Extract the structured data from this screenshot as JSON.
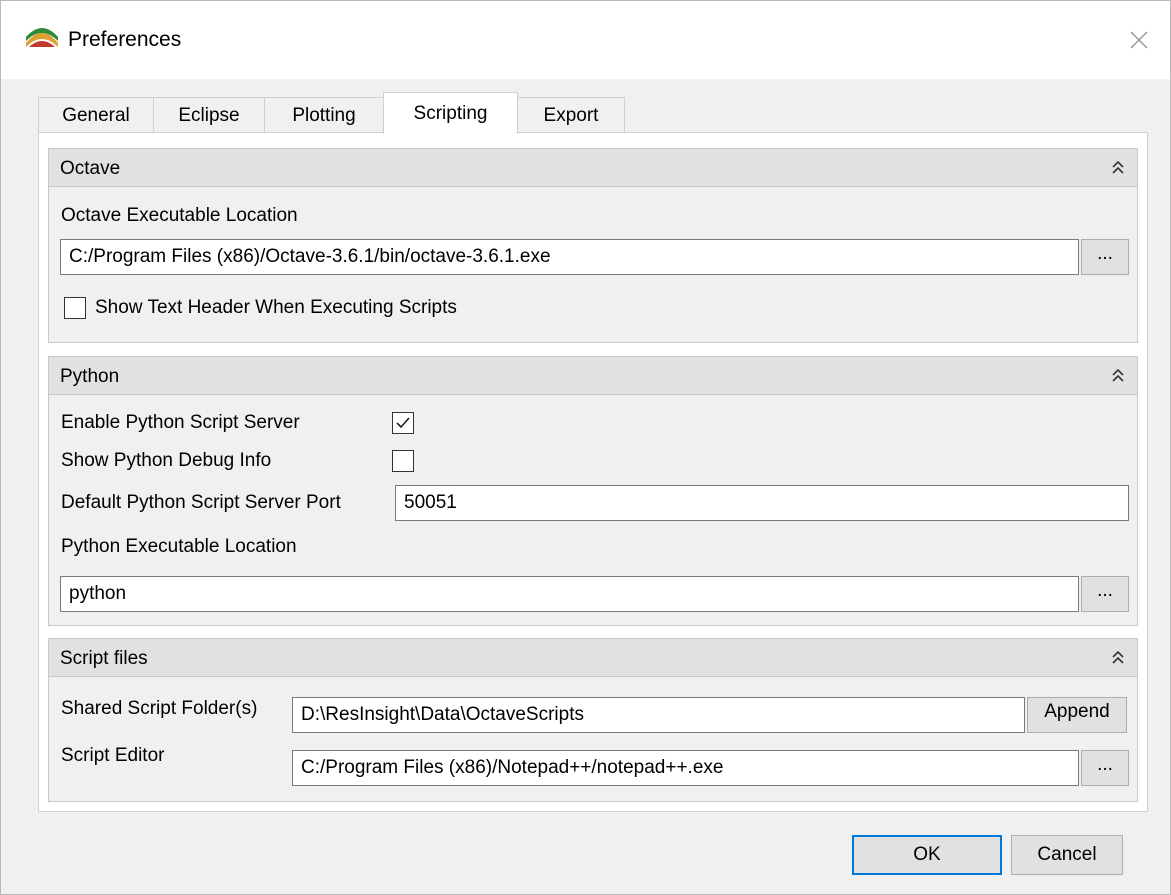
{
  "window": {
    "title": "Preferences"
  },
  "tabs": [
    "General",
    "Eclipse",
    "Plotting",
    "Scripting",
    "Export"
  ],
  "active_tab": "Scripting",
  "octave": {
    "title": "Octave",
    "executable_label": "Octave Executable Location",
    "executable_value": "C:/Program Files (x86)/Octave-3.6.1/bin/octave-3.6.1.exe",
    "browse_label": "...",
    "show_header_label": "Show Text Header When Executing Scripts",
    "show_header_checked": false
  },
  "python": {
    "title": "Python",
    "enable_server_label": "Enable Python Script Server",
    "enable_server_checked": true,
    "debug_info_label": "Show Python Debug Info",
    "debug_info_checked": false,
    "port_label": "Default Python Script Server Port",
    "port_value": "50051",
    "executable_label": "Python Executable Location",
    "executable_value": "python",
    "browse_label": "..."
  },
  "script_files": {
    "title": "Script files",
    "shared_folder_label": "Shared Script Folder(s)",
    "shared_folder_value": "D:\\ResInsight\\Data\\OctaveScripts",
    "append_label": "Append",
    "editor_label": "Script Editor",
    "editor_value": "C:/Program Files (x86)/Notepad++/notepad++.exe",
    "browse_label": "..."
  },
  "buttons": {
    "ok": "OK",
    "cancel": "Cancel"
  },
  "colors": {
    "default_button_border": "#0078d7",
    "group_header_bg": "#e1e1e1"
  },
  "icons": {
    "app": "resinsight-app-icon",
    "close": "close-icon",
    "collapse": "collapse-double-chevron-up-icon",
    "check": "checkmark-icon"
  }
}
